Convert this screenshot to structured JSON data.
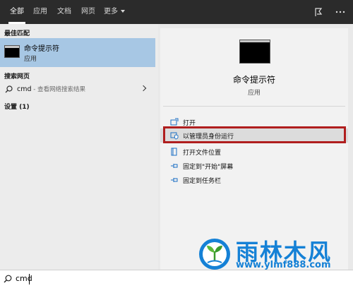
{
  "tabs": [
    {
      "label": "全部",
      "active": true
    },
    {
      "label": "应用"
    },
    {
      "label": "文档"
    },
    {
      "label": "网页"
    },
    {
      "label": "更多"
    }
  ],
  "top_icons": [
    "feedback-icon",
    "more-icon"
  ],
  "left": {
    "best_match_label": "最佳匹配",
    "best_match": {
      "title": "命令提示符",
      "subtitle": "应用",
      "icon": "command-prompt-icon"
    },
    "web_label": "搜索网页",
    "web_result": {
      "query": "cmd",
      "suffix": " - 查看网络搜索结果",
      "icon": "search-icon"
    },
    "settings_label": "设置 (1)"
  },
  "preview": {
    "title": "命令提示符",
    "subtitle": "应用",
    "actions": [
      {
        "label": "打开",
        "icon": "open-icon"
      },
      {
        "label": "以管理员身份运行",
        "icon": "shield-icon",
        "highlighted": true
      },
      {
        "label": "打开文件位置",
        "icon": "folder-icon"
      },
      {
        "label": "固定到\"开始\"屏幕",
        "icon": "pin-icon"
      },
      {
        "label": "固定到任务栏",
        "icon": "pin-icon"
      }
    ]
  },
  "search": {
    "value": "cmd",
    "icon": "search-icon"
  },
  "watermark": {
    "name": "雨林木风",
    "url": "www.ylmf888.com"
  },
  "colors": {
    "highlight_box": "#b01e1e",
    "selection": "#a7c7e4",
    "brand": "#1581d6"
  }
}
